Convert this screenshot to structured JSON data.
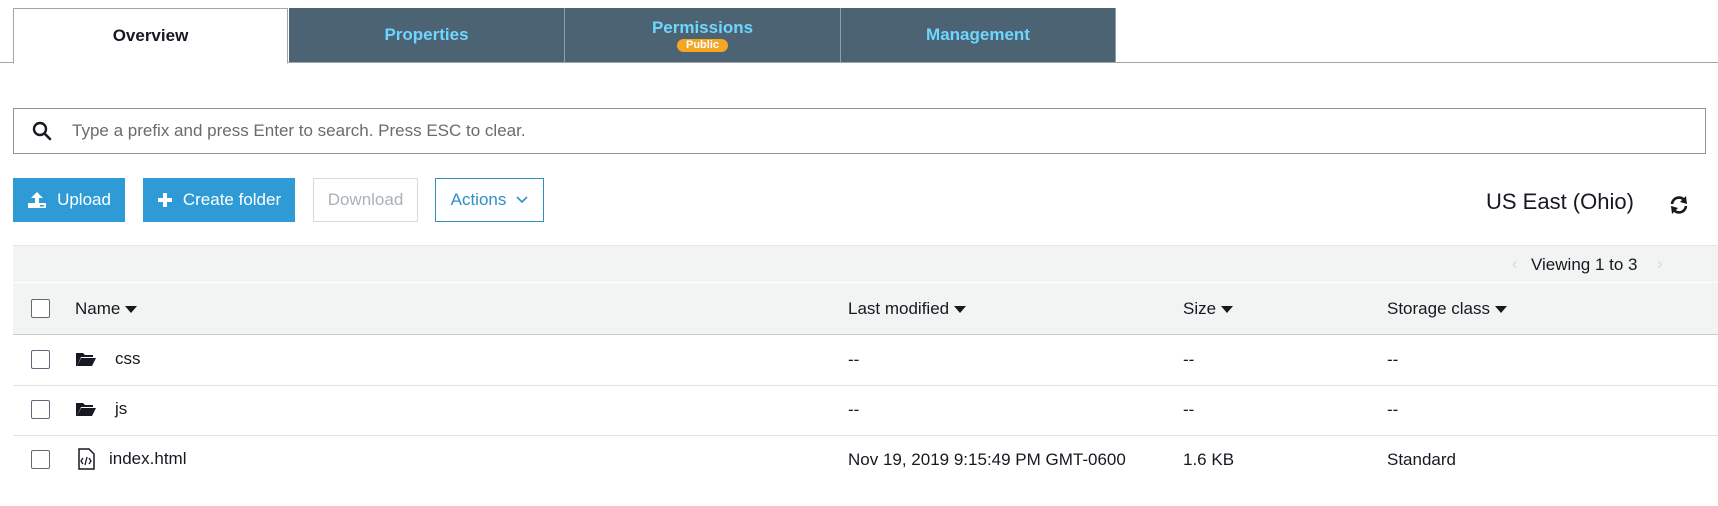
{
  "tabs": [
    {
      "label": "Overview",
      "active": true
    },
    {
      "label": "Properties",
      "active": false
    },
    {
      "label": "Permissions",
      "active": false,
      "badge": "Public"
    },
    {
      "label": "Management",
      "active": false
    }
  ],
  "search": {
    "placeholder": "Type a prefix and press Enter to search. Press ESC to clear.",
    "icon": "search-icon"
  },
  "toolbar": {
    "upload_label": "Upload",
    "create_folder_label": "Create folder",
    "download_label": "Download",
    "actions_label": "Actions",
    "region": "US East (Ohio)",
    "refresh_icon": "refresh-icon"
  },
  "pagination": {
    "viewing": "Viewing 1 to 3",
    "prev": "‹",
    "next": "›"
  },
  "table": {
    "columns": [
      "Name",
      "Last modified",
      "Size",
      "Storage class"
    ],
    "rows": [
      {
        "type": "folder",
        "name": "css",
        "last_modified": "--",
        "size": "--",
        "storage_class": "--"
      },
      {
        "type": "folder",
        "name": "js",
        "last_modified": "--",
        "size": "--",
        "storage_class": "--"
      },
      {
        "type": "file",
        "name": "index.html",
        "last_modified": "Nov 19, 2019 9:15:49 PM GMT-0600",
        "size": "1.6 KB",
        "storage_class": "Standard"
      }
    ]
  },
  "colors": {
    "primary": "#2f9bd6",
    "tab_inactive_bg": "#4b6373",
    "tab_inactive_text": "#6fd6ff",
    "badge": "#f5a623"
  }
}
